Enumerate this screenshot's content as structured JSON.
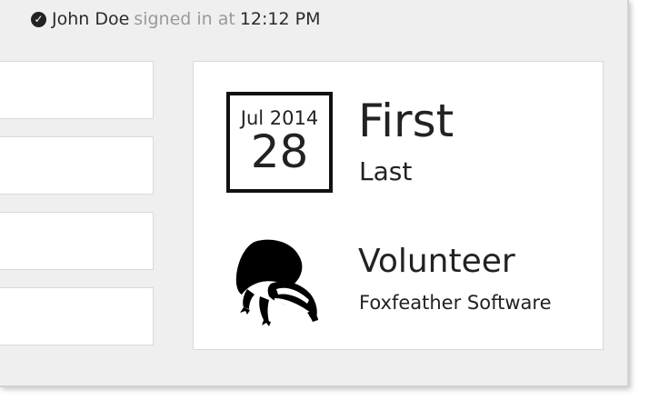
{
  "status_bar": {
    "user_name": "John Doe",
    "signed_in_text": "signed in at",
    "time": "12:12 PM",
    "status_icon": "check-circle-icon"
  },
  "badge": {
    "date_month_year": "Jul 2014",
    "date_day": "28",
    "first_name": "First",
    "last_name": "Last",
    "role": "Volunteer",
    "organization": "Foxfeather Software",
    "image_icon": "badger-icon"
  }
}
